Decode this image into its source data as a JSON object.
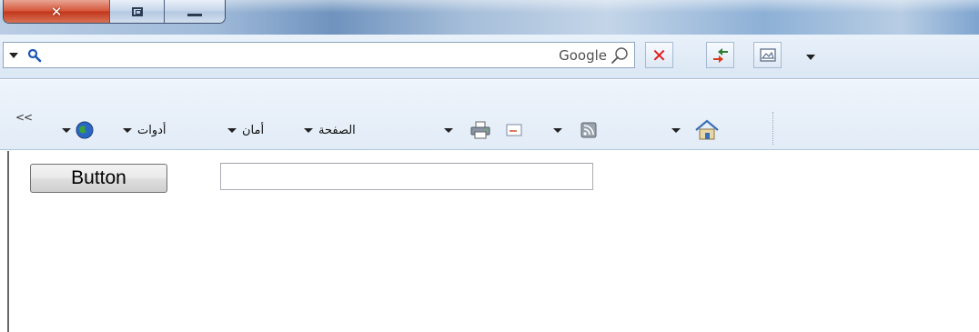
{
  "window": {
    "caption_buttons": [
      "close",
      "restore",
      "minimize"
    ]
  },
  "search": {
    "value": "",
    "provider": "Google"
  },
  "nav_buttons": [
    {
      "name": "stop-icon"
    },
    {
      "name": "refresh-icon"
    },
    {
      "name": "compatibility-view-icon"
    }
  ],
  "commandbar": {
    "chevron": "<<",
    "tools": "أدوات",
    "safety": "أمان",
    "page": "الصفحة"
  },
  "content": {
    "button_label": "Button",
    "textbox_value": ""
  },
  "colors": {
    "close_button": "#c2361c",
    "stop_icon": "#e21b1b",
    "command_bar_bg": "#e2ecf7"
  }
}
